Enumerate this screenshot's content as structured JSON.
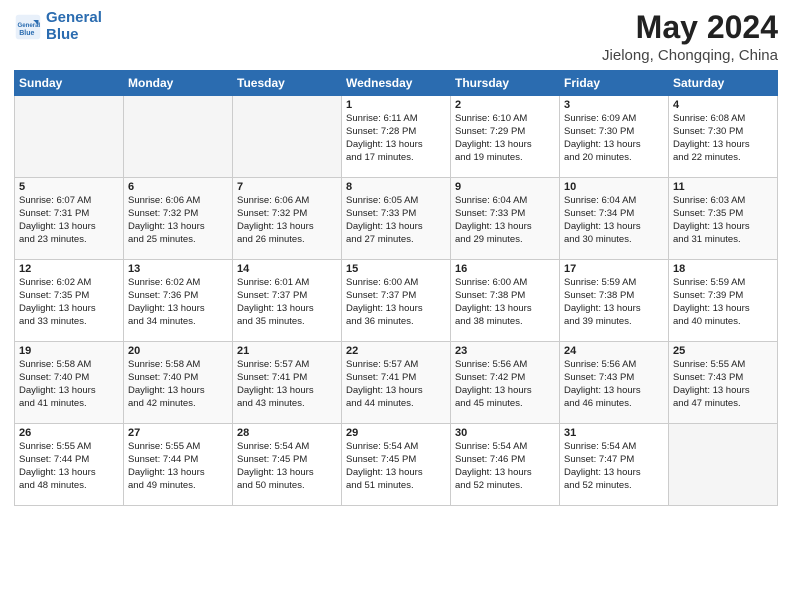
{
  "logo": {
    "line1": "General",
    "line2": "Blue"
  },
  "title": "May 2024",
  "subtitle": "Jielong, Chongqing, China",
  "weekdays": [
    "Sunday",
    "Monday",
    "Tuesday",
    "Wednesday",
    "Thursday",
    "Friday",
    "Saturday"
  ],
  "weeks": [
    [
      {
        "day": "",
        "info": ""
      },
      {
        "day": "",
        "info": ""
      },
      {
        "day": "",
        "info": ""
      },
      {
        "day": "1",
        "info": "Sunrise: 6:11 AM\nSunset: 7:28 PM\nDaylight: 13 hours\nand 17 minutes."
      },
      {
        "day": "2",
        "info": "Sunrise: 6:10 AM\nSunset: 7:29 PM\nDaylight: 13 hours\nand 19 minutes."
      },
      {
        "day": "3",
        "info": "Sunrise: 6:09 AM\nSunset: 7:30 PM\nDaylight: 13 hours\nand 20 minutes."
      },
      {
        "day": "4",
        "info": "Sunrise: 6:08 AM\nSunset: 7:30 PM\nDaylight: 13 hours\nand 22 minutes."
      }
    ],
    [
      {
        "day": "5",
        "info": "Sunrise: 6:07 AM\nSunset: 7:31 PM\nDaylight: 13 hours\nand 23 minutes."
      },
      {
        "day": "6",
        "info": "Sunrise: 6:06 AM\nSunset: 7:32 PM\nDaylight: 13 hours\nand 25 minutes."
      },
      {
        "day": "7",
        "info": "Sunrise: 6:06 AM\nSunset: 7:32 PM\nDaylight: 13 hours\nand 26 minutes."
      },
      {
        "day": "8",
        "info": "Sunrise: 6:05 AM\nSunset: 7:33 PM\nDaylight: 13 hours\nand 27 minutes."
      },
      {
        "day": "9",
        "info": "Sunrise: 6:04 AM\nSunset: 7:33 PM\nDaylight: 13 hours\nand 29 minutes."
      },
      {
        "day": "10",
        "info": "Sunrise: 6:04 AM\nSunset: 7:34 PM\nDaylight: 13 hours\nand 30 minutes."
      },
      {
        "day": "11",
        "info": "Sunrise: 6:03 AM\nSunset: 7:35 PM\nDaylight: 13 hours\nand 31 minutes."
      }
    ],
    [
      {
        "day": "12",
        "info": "Sunrise: 6:02 AM\nSunset: 7:35 PM\nDaylight: 13 hours\nand 33 minutes."
      },
      {
        "day": "13",
        "info": "Sunrise: 6:02 AM\nSunset: 7:36 PM\nDaylight: 13 hours\nand 34 minutes."
      },
      {
        "day": "14",
        "info": "Sunrise: 6:01 AM\nSunset: 7:37 PM\nDaylight: 13 hours\nand 35 minutes."
      },
      {
        "day": "15",
        "info": "Sunrise: 6:00 AM\nSunset: 7:37 PM\nDaylight: 13 hours\nand 36 minutes."
      },
      {
        "day": "16",
        "info": "Sunrise: 6:00 AM\nSunset: 7:38 PM\nDaylight: 13 hours\nand 38 minutes."
      },
      {
        "day": "17",
        "info": "Sunrise: 5:59 AM\nSunset: 7:38 PM\nDaylight: 13 hours\nand 39 minutes."
      },
      {
        "day": "18",
        "info": "Sunrise: 5:59 AM\nSunset: 7:39 PM\nDaylight: 13 hours\nand 40 minutes."
      }
    ],
    [
      {
        "day": "19",
        "info": "Sunrise: 5:58 AM\nSunset: 7:40 PM\nDaylight: 13 hours\nand 41 minutes."
      },
      {
        "day": "20",
        "info": "Sunrise: 5:58 AM\nSunset: 7:40 PM\nDaylight: 13 hours\nand 42 minutes."
      },
      {
        "day": "21",
        "info": "Sunrise: 5:57 AM\nSunset: 7:41 PM\nDaylight: 13 hours\nand 43 minutes."
      },
      {
        "day": "22",
        "info": "Sunrise: 5:57 AM\nSunset: 7:41 PM\nDaylight: 13 hours\nand 44 minutes."
      },
      {
        "day": "23",
        "info": "Sunrise: 5:56 AM\nSunset: 7:42 PM\nDaylight: 13 hours\nand 45 minutes."
      },
      {
        "day": "24",
        "info": "Sunrise: 5:56 AM\nSunset: 7:43 PM\nDaylight: 13 hours\nand 46 minutes."
      },
      {
        "day": "25",
        "info": "Sunrise: 5:55 AM\nSunset: 7:43 PM\nDaylight: 13 hours\nand 47 minutes."
      }
    ],
    [
      {
        "day": "26",
        "info": "Sunrise: 5:55 AM\nSunset: 7:44 PM\nDaylight: 13 hours\nand 48 minutes."
      },
      {
        "day": "27",
        "info": "Sunrise: 5:55 AM\nSunset: 7:44 PM\nDaylight: 13 hours\nand 49 minutes."
      },
      {
        "day": "28",
        "info": "Sunrise: 5:54 AM\nSunset: 7:45 PM\nDaylight: 13 hours\nand 50 minutes."
      },
      {
        "day": "29",
        "info": "Sunrise: 5:54 AM\nSunset: 7:45 PM\nDaylight: 13 hours\nand 51 minutes."
      },
      {
        "day": "30",
        "info": "Sunrise: 5:54 AM\nSunset: 7:46 PM\nDaylight: 13 hours\nand 52 minutes."
      },
      {
        "day": "31",
        "info": "Sunrise: 5:54 AM\nSunset: 7:47 PM\nDaylight: 13 hours\nand 52 minutes."
      },
      {
        "day": "",
        "info": ""
      }
    ]
  ]
}
